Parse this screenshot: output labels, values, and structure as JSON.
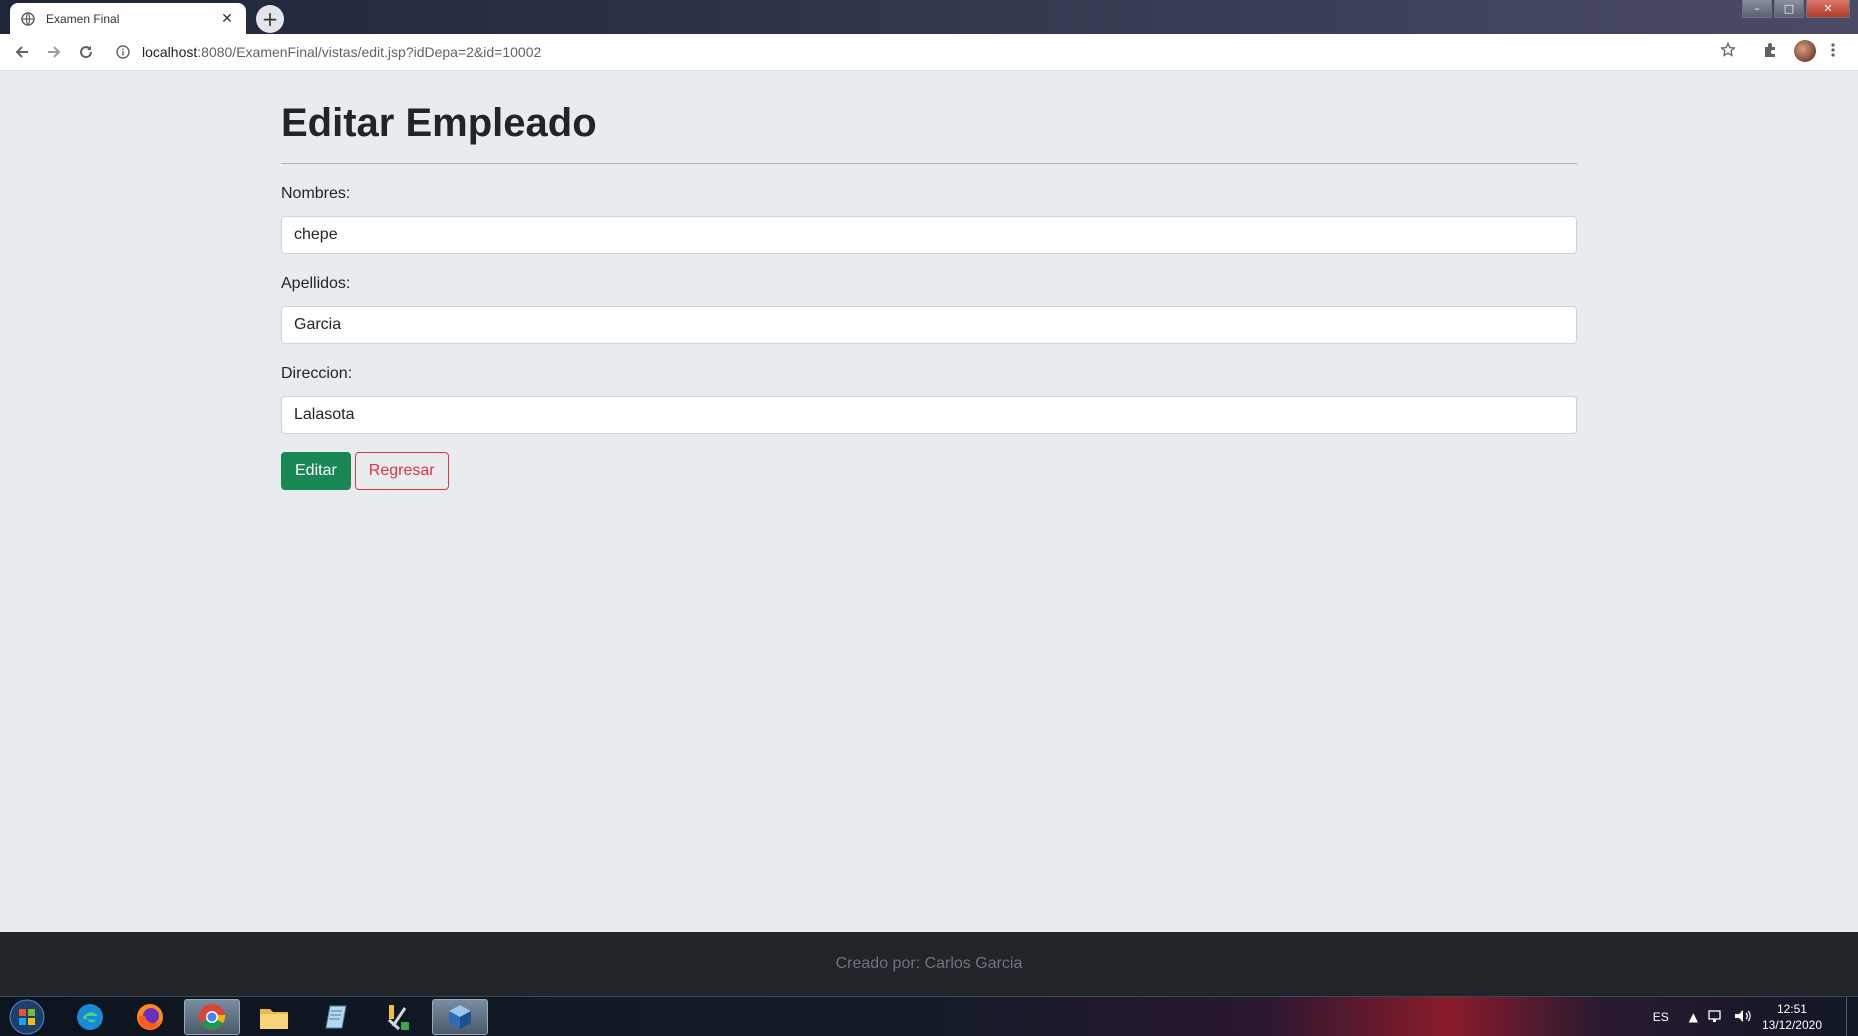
{
  "browser": {
    "tab_title": "Examen Final",
    "tab_close": "✕",
    "new_tab": "+",
    "url_host": "localhost",
    "url_rest": ":8080/ExamenFinal/vistas/edit.jsp?idDepa=2&id=10002",
    "window_controls": {
      "minimize": "–",
      "maximize": "□",
      "close": "✕"
    }
  },
  "page": {
    "title": "Editar Empleado",
    "fields": [
      {
        "label": "Nombres:",
        "value": "chepe"
      },
      {
        "label": "Apellidos:",
        "value": "Garcia"
      },
      {
        "label": "Direccion:",
        "value": "Lalasota"
      }
    ],
    "buttons": {
      "submit": "Editar",
      "back": "Regresar"
    },
    "footer": "Creado por: Carlos Garcia"
  },
  "taskbar": {
    "language": "ES",
    "time": "12:51",
    "date": "13/12/2020",
    "apps": [
      "edge-icon",
      "firefox-icon",
      "chrome-icon",
      "file-explorer-icon",
      "notepad-icon",
      "tools-icon",
      "virtualbox-icon"
    ]
  },
  "colors": {
    "page_bg": "#e9ecef",
    "success": "#198754",
    "danger": "#dc3545",
    "footer_bg": "#212529",
    "footer_text": "#6c757d"
  }
}
